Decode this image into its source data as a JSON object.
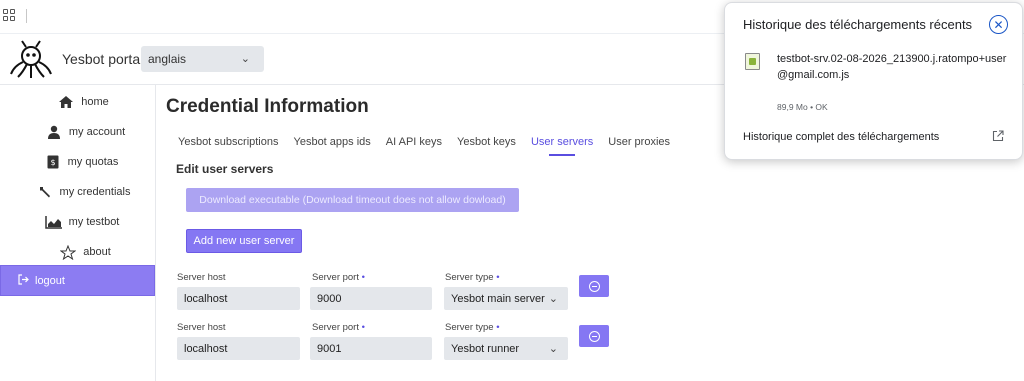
{
  "header": {
    "portal_title": "Yesbot portal",
    "language_value": "anglais"
  },
  "sidebar": {
    "items": [
      {
        "label": "home",
        "icon": "home-icon"
      },
      {
        "label": "my account",
        "icon": "user-icon"
      },
      {
        "label": "my quotas",
        "icon": "quota-icon"
      },
      {
        "label": "my credentials",
        "icon": "wrench-icon"
      },
      {
        "label": "my testbot",
        "icon": "chart-icon"
      },
      {
        "label": "about",
        "icon": "star-icon"
      }
    ],
    "logout_label": "logout"
  },
  "main": {
    "title": "Credential Information",
    "tabs": [
      {
        "label": "Yesbot subscriptions",
        "active": false
      },
      {
        "label": "Yesbot apps ids",
        "active": false
      },
      {
        "label": "AI API keys",
        "active": false
      },
      {
        "label": "Yesbot keys",
        "active": false
      },
      {
        "label": "User servers",
        "active": true
      },
      {
        "label": "User proxies",
        "active": false
      }
    ],
    "section_title": "Edit user servers",
    "download_button": "Download executable (Download timeout does not allow dowload)",
    "add_button": "Add new user server",
    "labels": {
      "host": "Server host",
      "port": "Server port",
      "type": "Server type",
      "required_marker": "•"
    },
    "servers": [
      {
        "host": "localhost",
        "port": "9000",
        "type": "Yesbot main server"
      },
      {
        "host": "localhost",
        "port": "9001",
        "type": "Yesbot runner"
      }
    ]
  },
  "downloads_panel": {
    "title": "Historique des téléchargements récents",
    "file_name": "testbot-srv.02-08-2026_213900.j.ratompo+user@gmail.com.js",
    "file_meta": "89,9 Mo • OK",
    "full_history_label": "Historique complet des téléchargements"
  },
  "colors": {
    "accent": "#8577f3",
    "active_tab": "#5a4ee0",
    "field_bg": "#e4e7eb"
  }
}
